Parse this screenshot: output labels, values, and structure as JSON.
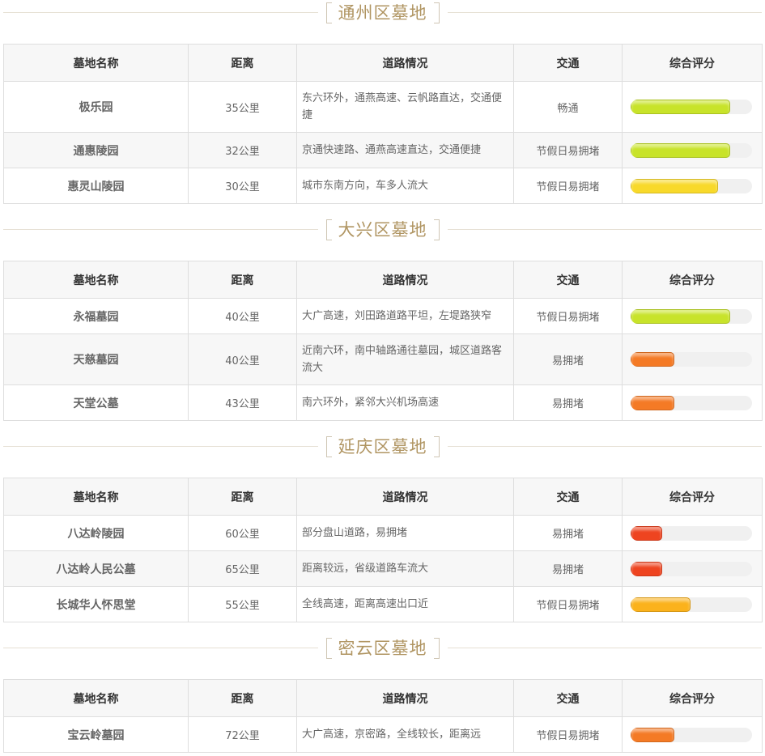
{
  "headers": [
    "墓地名称",
    "距离",
    "道路情况",
    "交通",
    "综合评分"
  ],
  "sections": [
    {
      "title": "通州区墓地",
      "rows": [
        {
          "name": "极乐园",
          "distance": "35公里",
          "road": "东六环外，通燕高速、云帆路直达，交通便捷",
          "traffic": "畅通",
          "score": 0.82,
          "color": "#c8e32a"
        },
        {
          "name": "通惠陵园",
          "distance": "32公里",
          "road": "京通快速路、通燕高速直达，交通便捷",
          "traffic": "节假日易拥堵",
          "score": 0.82,
          "color": "#c8e32a"
        },
        {
          "name": "惠灵山陵园",
          "distance": "30公里",
          "road": "城市东南方向，车多人流大",
          "traffic": "节假日易拥堵",
          "score": 0.72,
          "color": "#f8d92a"
        }
      ]
    },
    {
      "title": "大兴区墓地",
      "rows": [
        {
          "name": "永福墓园",
          "distance": "40公里",
          "road": "大广高速，刘田路道路平坦，左堤路狭窄",
          "traffic": "节假日易拥堵",
          "score": 0.82,
          "color": "#c8e32a"
        },
        {
          "name": "天慈墓园",
          "distance": "40公里",
          "road": "近南六环，南中轴路通往墓园，城区道路客流大",
          "traffic": "易拥堵",
          "score": 0.36,
          "color": "#f47a25"
        },
        {
          "name": "天堂公墓",
          "distance": "43公里",
          "road": "南六环外，紧邻大兴机场高速",
          "traffic": "易拥堵",
          "score": 0.36,
          "color": "#f47a25"
        }
      ]
    },
    {
      "title": "延庆区墓地",
      "rows": [
        {
          "name": "八达岭陵园",
          "distance": "60公里",
          "road": "部分盘山道路，易拥堵",
          "traffic": "易拥堵",
          "score": 0.26,
          "color": "#ee4420"
        },
        {
          "name": "八达岭人民公墓",
          "distance": "65公里",
          "road": "距离较远，省级道路车流大",
          "traffic": "易拥堵",
          "score": 0.26,
          "color": "#ee4420"
        },
        {
          "name": "长城华人怀思堂",
          "distance": "55公里",
          "road": "全线高速，距离高速出口近",
          "traffic": "节假日易拥堵",
          "score": 0.49,
          "color": "#fbb21c"
        }
      ]
    },
    {
      "title": "密云区墓地",
      "rows": [
        {
          "name": "宝云岭墓园",
          "distance": "72公里",
          "road": "大广高速，京密路，全线较长，距离远",
          "traffic": "节假日易拥堵",
          "score": 0.36,
          "color": "#f47a25"
        }
      ]
    }
  ]
}
